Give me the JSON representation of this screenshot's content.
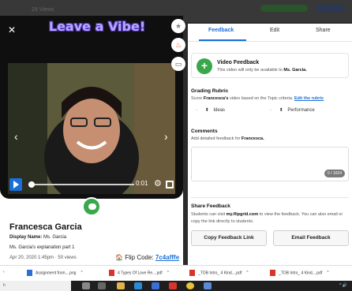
{
  "top_strip": {
    "faded_text": "29 Views"
  },
  "video": {
    "sticker_text": "Leave a Vibe!",
    "time": "0:01",
    "progress": 0.02
  },
  "responder": {
    "name": "Francesca Garcia",
    "display_label": "Display Name:",
    "display_value": "Ms. Garcia",
    "description": "Ms. Garcia's explanation part 1",
    "meta": "Apr 20, 2020 1:45pm · 50 views",
    "flip_code_label": "Flip Code:",
    "flip_code": "7c4afffe"
  },
  "tabs": [
    "Feedback",
    "Edit",
    "Share"
  ],
  "video_feedback": {
    "title": "Video Feedback",
    "sub_prefix": "This video will only be available to ",
    "sub_name": "Ms. Garcia."
  },
  "rubric": {
    "title": "Grading Rubric",
    "text_prefix": "Score ",
    "text_name": "Francesca's",
    "text_mid": " video based on the Topic criteria. ",
    "link": "Edit the rubric",
    "criteria": [
      {
        "label": "Ideas",
        "value": "-"
      },
      {
        "label": "Performance",
        "value": "-"
      }
    ]
  },
  "comments": {
    "title": "Comments",
    "text_prefix": "Add detailed feedback for ",
    "text_name": "Francesca.",
    "counter": "0 / 1024"
  },
  "share": {
    "title": "Share Feedback",
    "text_prefix": "Students can visit ",
    "site": "my.flipgrid.com",
    "text_suffix": " to view the feedback. You can also email or copy the link directly to students."
  },
  "buttons": {
    "copy": "Copy Feedback Link",
    "email": "Email Feedback"
  },
  "downloads": [
    {
      "name": "Assignment from....png",
      "icon_color": "#2b6fd6"
    },
    {
      "name": "4 Types Of Love Re....pdf",
      "icon_color": "#d9342b"
    },
    {
      "name": "_TOB Intro_ 4 Kind....pdf",
      "icon_color": "#d9342b"
    },
    {
      "name": "_TOB Intro_ 4 Kind....pdf",
      "icon_color": "#d9342b"
    }
  ],
  "taskbar": {
    "search_text": "h",
    "tray": "^ 🔊"
  },
  "colors": {
    "accent": "#1a6fd8",
    "brand_green": "#3aa84a"
  }
}
